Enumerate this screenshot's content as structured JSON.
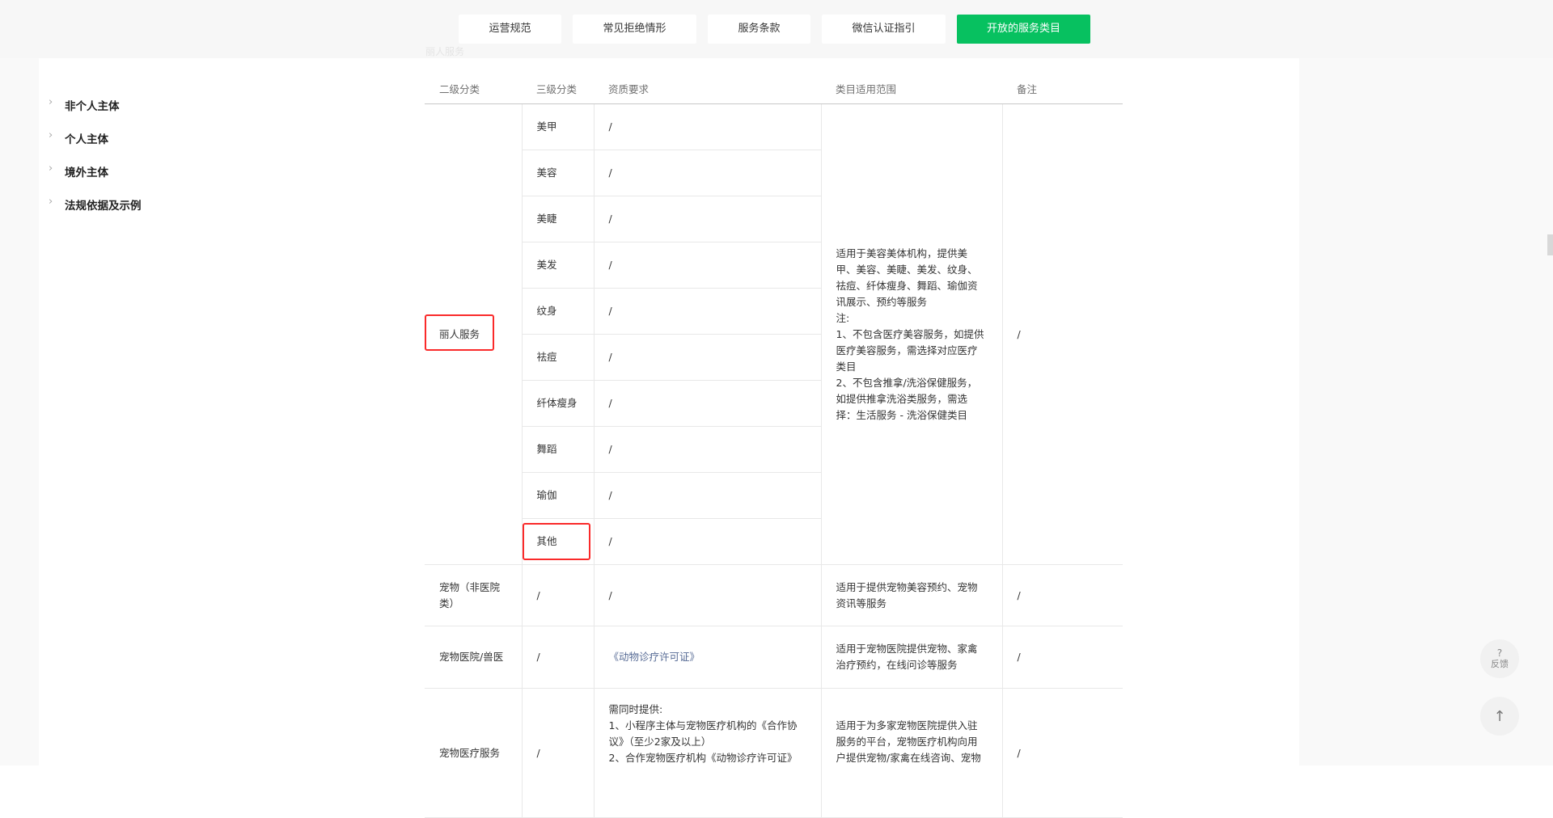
{
  "tabs": [
    {
      "label": "运营规范"
    },
    {
      "label": "常见拒绝情形"
    },
    {
      "label": "服务条款"
    },
    {
      "label": "微信认证指引"
    },
    {
      "label": "开放的服务类目",
      "active": true
    }
  ],
  "sidebar": {
    "items": [
      {
        "label": "非个人主体"
      },
      {
        "label": "个人主体"
      },
      {
        "label": "境外主体"
      },
      {
        "label": "法规依据及示例"
      }
    ]
  },
  "table": {
    "headers": [
      "二级分类",
      "三级分类",
      "资质要求",
      "类目适用范围",
      "备注"
    ],
    "liren": {
      "category": "丽人服务",
      "subs": [
        {
          "name": "美甲",
          "req": "/"
        },
        {
          "name": "美容",
          "req": "/"
        },
        {
          "name": "美睫",
          "req": "/"
        },
        {
          "name": "美发",
          "req": "/"
        },
        {
          "name": "纹身",
          "req": "/"
        },
        {
          "name": "祛痘",
          "req": "/"
        },
        {
          "name": "纤体瘦身",
          "req": "/"
        },
        {
          "name": "舞蹈",
          "req": "/"
        },
        {
          "name": "瑜伽",
          "req": "/"
        },
        {
          "name": "其他",
          "req": "/"
        }
      ],
      "scope_lines": [
        "适用于美容美体机构，提供美",
        "甲、美容、美睫、美发、纹身、",
        "祛痘、纤体瘦身、舞蹈、瑜伽资",
        "讯展示、预约等服务",
        "注:",
        "1、不包含医疗美容服务，如提供",
        "医疗美容服务，需选择对应医疗",
        "类目",
        "2、不包含推拿/洗浴保健服务，",
        "如提供推拿洗浴类服务，需选",
        "择：生活服务 - 洗浴保健类目"
      ],
      "note": "/"
    },
    "rows": [
      {
        "cat_lines": [
          "宠物（非医院",
          "类）"
        ],
        "sub": "/",
        "req": "/",
        "scope_lines": [
          "适用于提供宠物美容预约、宠物",
          "资讯等服务"
        ],
        "note": "/"
      },
      {
        "cat_lines": [
          "宠物医院/兽医"
        ],
        "sub": "/",
        "req": "《动物诊疗许可证》",
        "scope_lines": [
          "适用于宠物医院提供宠物、家禽",
          "治疗预约，在线问诊等服务"
        ],
        "note": "/"
      },
      {
        "cat_lines": [
          "宠物医疗服务"
        ],
        "sub": "/",
        "req_lines": [
          "需同时提供:",
          "1、小程序主体与宠物医疗机构的《合作协",
          "议》（至少2家及以上）",
          "2、合作宠物医疗机构《动物诊疗许可证》"
        ],
        "scope_lines": [
          "适用于为多家宠物医院提供入驻",
          "服务的平台，宠物医疗机构向用",
          "户提供宠物/家禽在线咨询、宠物"
        ],
        "note": "/"
      }
    ]
  },
  "faded_heading": "丽人服务",
  "fab": {
    "feedback_q": "?",
    "feedback_label": "反馈",
    "top_arrow": "↑"
  }
}
